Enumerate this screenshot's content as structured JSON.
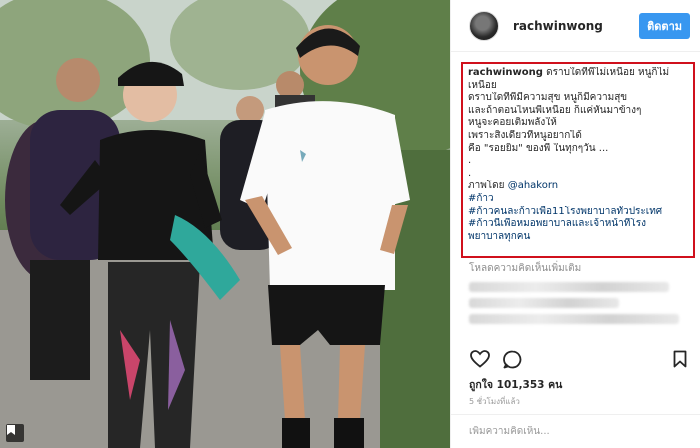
{
  "post": {
    "username": "rachwinwong",
    "follow_label": "ติดตาม",
    "caption_lines": [
      {
        "author": "rachwinwong",
        "text": " ดราบใดที่พี่ไม่เหนื่อย หนูก็ไม่"
      },
      {
        "text": "เหนื่อย"
      },
      {
        "text": "ดราบใดที่พี่มีความสุข หนูก็มีความสุข"
      },
      {
        "text": "และถ้าตอนไหนพี่เหนื่อย ก็แค่หันมาข้างๆ"
      },
      {
        "text": "หนูจะคอยเติมพลังให้"
      },
      {
        "text": "เพราะสิ่งเดียวที่หนูอยากได้"
      },
      {
        "text": "คือ \"รอยยิ้ม\" ของพี่ ในทุกๆวัน ..."
      },
      {
        "text": "."
      },
      {
        "text": "."
      },
      {
        "label": "ภาพโดย ",
        "link": "@ahakorn"
      },
      {
        "link": "#ก้าว"
      },
      {
        "link": "#ก้าวคนละก้าวเพื่อ11โรงพยาบาลทั่วประเทศ"
      },
      {
        "link": "#ก้าวนี้เพื่อหมอพยาบาลและเจ้าหน้าที่โรง"
      },
      {
        "link": "พยาบาลทุกคน"
      }
    ],
    "load_more_comments": "โหลดความคิดเห็นเพิ่มเติม",
    "likes": "ถูกใจ 101,353 คน",
    "timestamp": "5 ชั่วโมงที่แล้ว",
    "comment_placeholder": "เพิ่มความคิดเห็น...",
    "icons": {
      "like": "heart-icon",
      "comment": "speech-bubble-icon",
      "save": "bookmark-icon",
      "photo_corner": "save-to-collection-icon"
    }
  },
  "colors": {
    "follow_button": "#3897f0",
    "highlight_box": "#d0101c",
    "link": "#003569"
  }
}
